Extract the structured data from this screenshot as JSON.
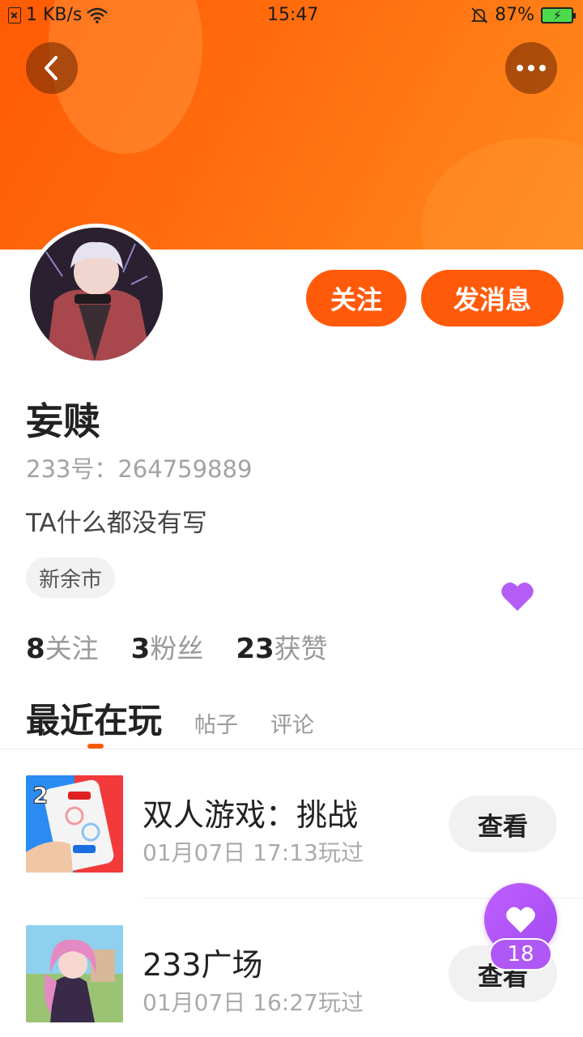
{
  "status_bar": {
    "network_speed": "1 KB/s",
    "time": "15:47",
    "battery": "87%"
  },
  "icons": {
    "back": "back-arrow-icon",
    "more": "more-dots-icon",
    "like": "heart-icon"
  },
  "profile": {
    "username": "妄赎",
    "id_text": "233号：264759889",
    "bio": "TA什么都没有写",
    "location": "新余市",
    "follow_label": "关注",
    "message_label": "发消息"
  },
  "stats": [
    {
      "value": "8",
      "label": "关注"
    },
    {
      "value": "3",
      "label": "粉丝"
    },
    {
      "value": "23",
      "label": "获赞"
    }
  ],
  "tabs": [
    {
      "label": "最近在玩",
      "active": true
    },
    {
      "label": "帖子",
      "active": false
    },
    {
      "label": "评论",
      "active": false
    }
  ],
  "games": [
    {
      "title": "双人游戏：挑战",
      "time": "01月07日 17:13玩过",
      "action": "查看"
    },
    {
      "title": "233广场",
      "time": "01月07日 16:27玩过",
      "action": "查看"
    }
  ],
  "floating_like": {
    "count": "18"
  },
  "colors": {
    "accent": "#ff5a0a",
    "banner_start": "#ff5a05",
    "banner_end": "#ff8a1c",
    "like_purple": "#b058f5"
  }
}
